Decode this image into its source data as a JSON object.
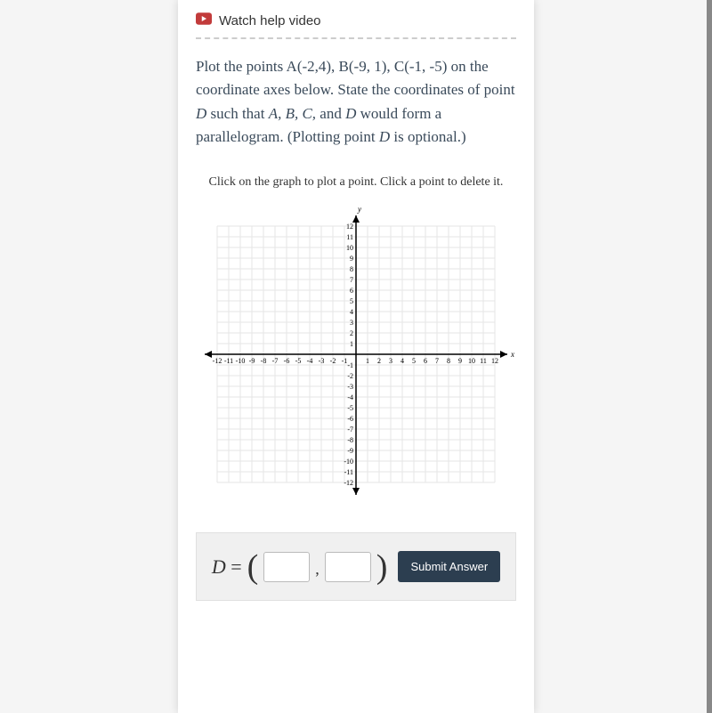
{
  "help_video_label": "Watch help video",
  "question": {
    "line1": "Plot the points A(-2,4), B(-9, 1), C(-1, -5) on the coordinate axes below. State the coordinates of point ",
    "point_d": "D",
    "line2": " such that ",
    "pts": "A, B, C,",
    "line3": " and ",
    "pt_d2": "D",
    "line4": " would form a parallelogram. (Plotting point ",
    "pt_d3": "D",
    "line5": " is optional.)"
  },
  "instruction": "Click on the graph to plot a point. Click a point to delete it.",
  "graph": {
    "x_label": "x",
    "y_label": "y",
    "x_min": -12,
    "x_max": 12,
    "y_min": -12,
    "y_max": 12
  },
  "answer": {
    "label_d": "D",
    "equals": " = ",
    "x_value": "",
    "y_value": ""
  },
  "submit_label": "Submit Answer"
}
